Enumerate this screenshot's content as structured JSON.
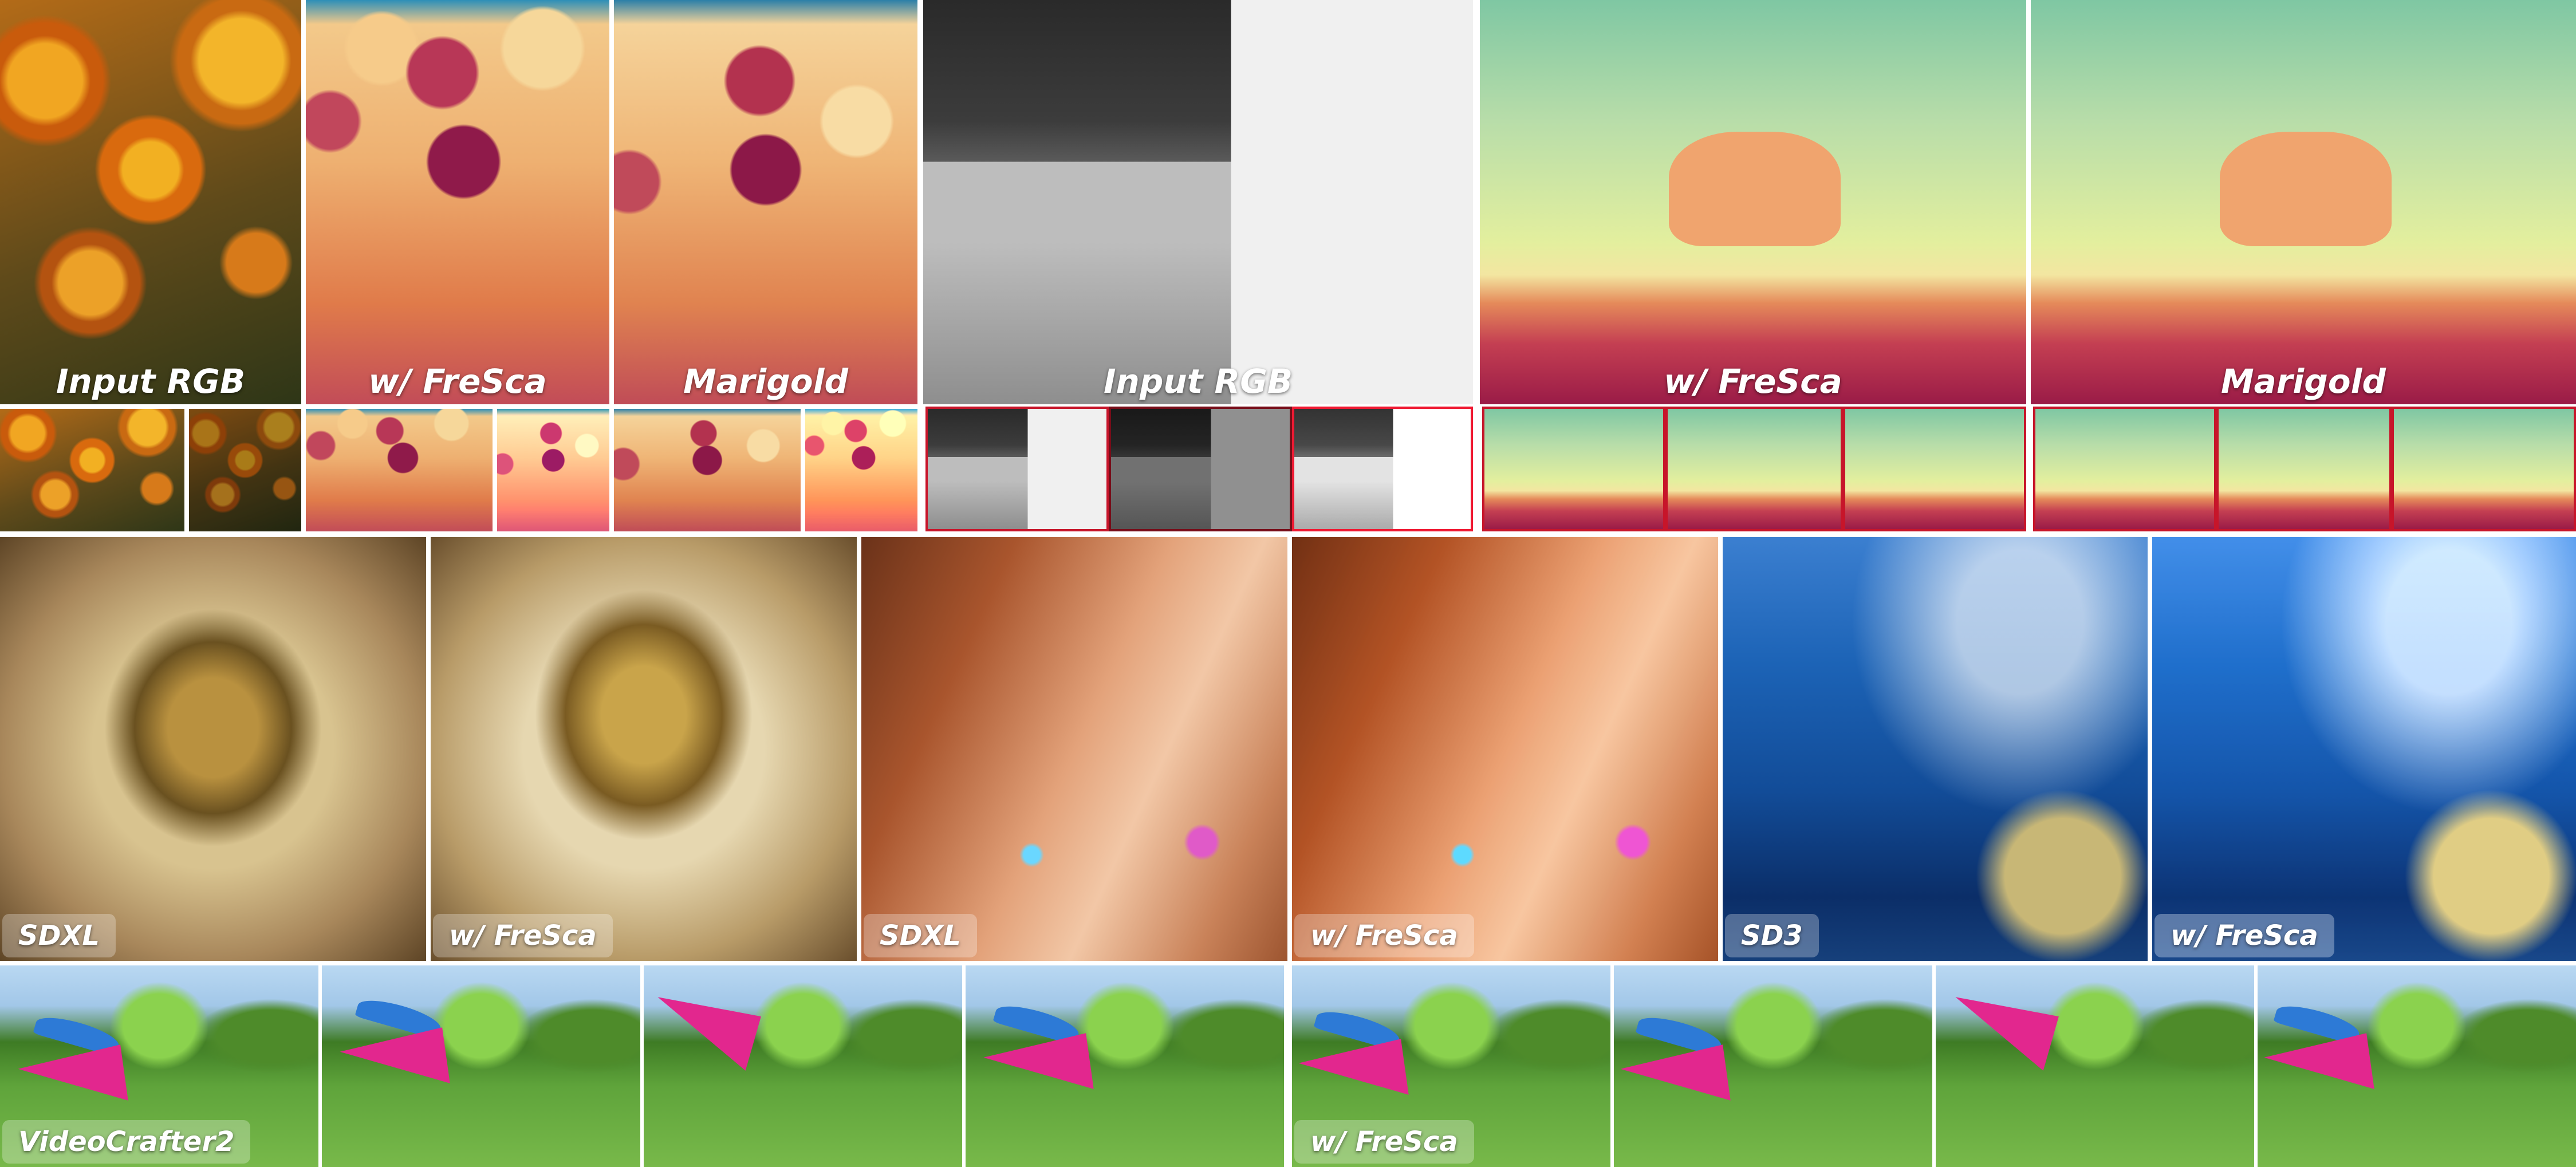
{
  "labels": {
    "input_rgb": "Input RGB",
    "w_fresca": "w/ FreSca",
    "marigold": "Marigold",
    "sdxl": "SDXL",
    "sd3": "SD3",
    "videocrafter2": "VideoCrafter2"
  }
}
